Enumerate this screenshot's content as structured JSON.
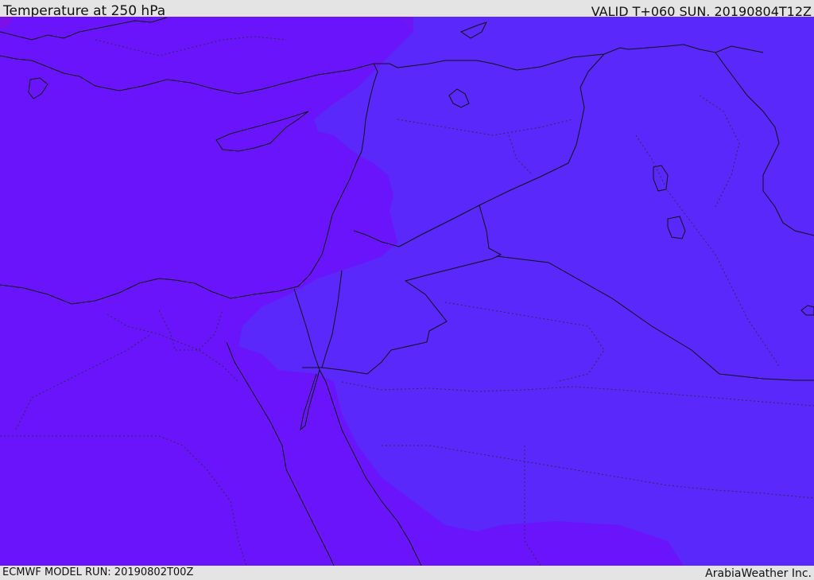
{
  "header": {
    "title": "Temperature at 250 hPa",
    "valid_time": "VALID T+060 SUN. 20190804T12Z"
  },
  "footer": {
    "model_run": "ECMWF MODEL RUN: 20190802T00Z",
    "credit": "ArabiaWeather Inc."
  },
  "map": {
    "colors": {
      "cold_field": "#6a14fb",
      "warmer_field": "#5a28fb",
      "warm_patch": "#8010e8",
      "coastline": "#111111",
      "border": "#111111",
      "admin_border": "#333366"
    }
  }
}
